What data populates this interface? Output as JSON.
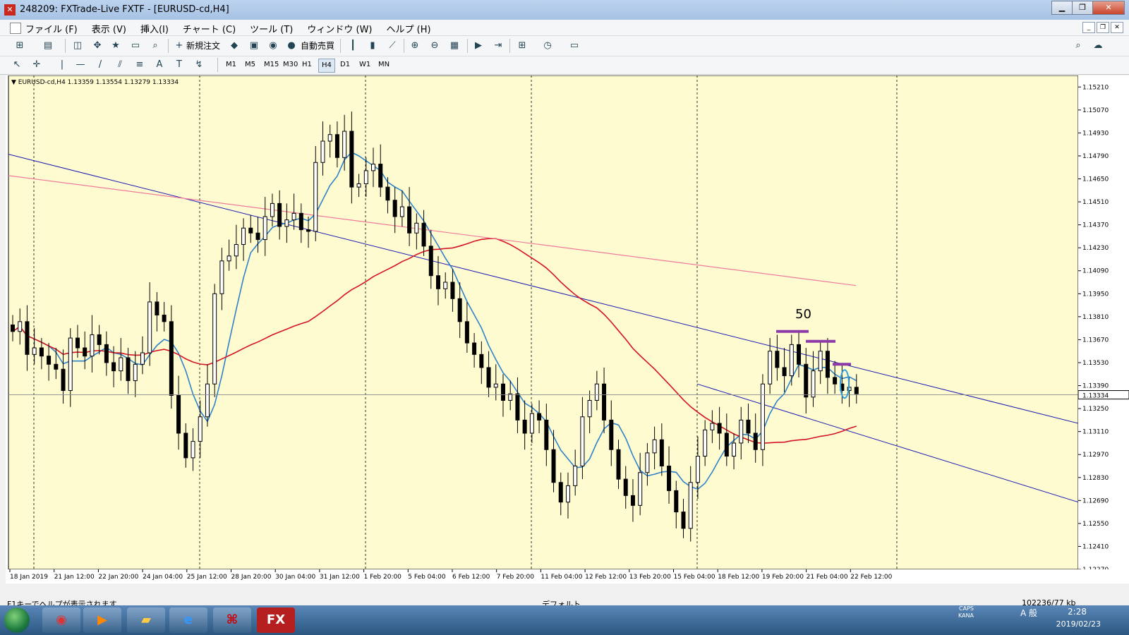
{
  "window": {
    "title": "248209: FXTrade-Live FXTF - [EURUSD-cd,H4]",
    "app_icon": "fx-app-icon"
  },
  "menu": {
    "items": [
      "ファイル (F)",
      "表示 (V)",
      "挿入(I)",
      "チャート (C)",
      "ツール (T)",
      "ウィンドウ (W)",
      "ヘルプ (H)"
    ]
  },
  "toolbar": {
    "new_order": "新規注文",
    "auto_trade": "自動売買"
  },
  "timeframes": [
    "M1",
    "M5",
    "M15",
    "M30",
    "H1",
    "H4",
    "D1",
    "W1",
    "MN"
  ],
  "active_timeframe": "H4",
  "chart_info": "EURUSD-cd,H4  1.13359 1.13554 1.13279 1.13334",
  "current_price": "1.13334",
  "annotation": "50",
  "status": {
    "help": "F1キーでヘルプが表示されます",
    "profile": "デフォルト",
    "traffic": "102236/77 kb"
  },
  "taskbar": {
    "time": "2:28",
    "date": "2019/02/23",
    "ime": "A 般",
    "caps": "CAPS",
    "kana": "KANA"
  },
  "chart_data": {
    "type": "candlestick",
    "symbol": "EURUSD-cd",
    "timeframe": "H4",
    "ylim": [
      1.1227,
      1.1528
    ],
    "y_ticks": [
      "1.15210",
      "1.15070",
      "1.14930",
      "1.14790",
      "1.14650",
      "1.14510",
      "1.14370",
      "1.14230",
      "1.14090",
      "1.13950",
      "1.13810",
      "1.13670",
      "1.13530",
      "1.13390",
      "1.13250",
      "1.13110",
      "1.12970",
      "1.12830",
      "1.12690",
      "1.12550",
      "1.12410",
      "1.12270"
    ],
    "x_ticks": [
      "18 Jan 2019",
      "21 Jan 12:00",
      "22 Jan 20:00",
      "24 Jan 04:00",
      "25 Jan 12:00",
      "28 Jan 20:00",
      "30 Jan 04:00",
      "31 Jan 12:00",
      "1 Feb 20:00",
      "5 Feb 04:00",
      "6 Feb 12:00",
      "7 Feb 20:00",
      "11 Feb 04:00",
      "12 Feb 12:00",
      "13 Feb 20:00",
      "15 Feb 04:00",
      "18 Feb 12:00",
      "19 Feb 20:00",
      "21 Feb 04:00",
      "22 Feb 12:00"
    ],
    "candle_closes": [
      1.1372,
      1.1378,
      1.1358,
      1.1362,
      1.1357,
      1.1352,
      1.1349,
      1.1336,
      1.1368,
      1.1362,
      1.1357,
      1.137,
      1.1364,
      1.1353,
      1.1348,
      1.1356,
      1.1342,
      1.1352,
      1.1359,
      1.139,
      1.1382,
      1.1378,
      1.1333,
      1.131,
      1.1295,
      1.1305,
      1.132,
      1.134,
      1.1395,
      1.1415,
      1.1418,
      1.1425,
      1.1435,
      1.1432,
      1.1428,
      1.1442,
      1.145,
      1.1436,
      1.144,
      1.1444,
      1.1434,
      1.1433,
      1.1475,
      1.1488,
      1.1492,
      1.1478,
      1.1494,
      1.146,
      1.1462,
      1.147,
      1.1474,
      1.146,
      1.1452,
      1.1442,
      1.1448,
      1.1432,
      1.1438,
      1.1424,
      1.1406,
      1.1398,
      1.1402,
      1.1392,
      1.1378,
      1.1365,
      1.1358,
      1.135,
      1.1338,
      1.134,
      1.133,
      1.1334,
      1.1318,
      1.131,
      1.1322,
      1.1318,
      1.13,
      1.128,
      1.1268,
      1.1278,
      1.129,
      1.132,
      1.133,
      1.134,
      1.1318,
      1.13,
      1.1282,
      1.1272,
      1.1266,
      1.1286,
      1.1298,
      1.1306,
      1.129,
      1.1275,
      1.1262,
      1.1252,
      1.128,
      1.1296,
      1.1312,
      1.1316,
      1.131,
      1.1296,
      1.1304,
      1.1318,
      1.131,
      1.13,
      1.134,
      1.136,
      1.135,
      1.1345,
      1.1364,
      1.1352,
      1.1332,
      1.1348,
      1.136,
      1.1344,
      1.134,
      1.1336,
      1.1338,
      1.1334
    ],
    "ma_colors": {
      "ma_short": "#2e82c8",
      "ma_long": "#d41423",
      "ma_longest": "#f07a9a"
    },
    "trendline_color": "#1a1ab4",
    "annotation_color": "#8b3aa8",
    "background": "#fffbd1"
  }
}
